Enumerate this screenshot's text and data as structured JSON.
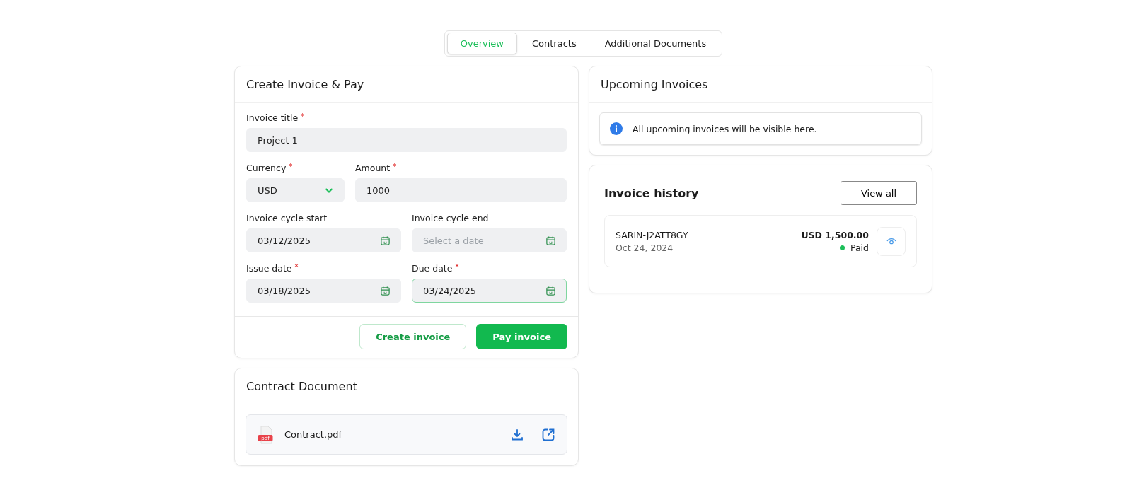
{
  "tabs": [
    {
      "label": "Overview",
      "selected": true
    },
    {
      "label": "Contracts",
      "selected": false
    },
    {
      "label": "Additional Documents",
      "selected": false
    }
  ],
  "create_invoice": {
    "title": "Create Invoice & Pay",
    "rows": [
      [
        {
          "kind": "text",
          "label": "Invoice title",
          "required": true,
          "value": "Project 1",
          "focused": false
        }
      ],
      [
        {
          "kind": "select",
          "label": "Currency",
          "required": true,
          "value": "USD",
          "focused": false
        },
        {
          "kind": "text",
          "label": "Amount",
          "required": true,
          "value": "1000",
          "focused": false
        }
      ],
      [
        {
          "kind": "date",
          "label": "Invoice cycle start",
          "required": false,
          "value": "03/12/2025",
          "focused": false
        },
        {
          "kind": "date",
          "label": "Invoice cycle end",
          "required": false,
          "placeholder": "Select a date",
          "focused": false
        }
      ],
      [
        {
          "kind": "date",
          "label": "Issue date",
          "required": true,
          "value": "03/18/2025",
          "focused": false
        },
        {
          "kind": "date",
          "label": "Due date",
          "required": true,
          "value": "03/24/2025",
          "focused": true
        }
      ]
    ],
    "required_mark": "*",
    "buttons": [
      {
        "label": "Create invoice",
        "kind": "outline"
      },
      {
        "label": "Pay invoice",
        "kind": "primary"
      }
    ]
  },
  "contract_document": {
    "title": "Contract Document",
    "file": {
      "name": "Contract.pdf",
      "type_badge": "pdf"
    }
  },
  "upcoming_invoices": {
    "title": "Upcoming Invoices",
    "notice": "All upcoming invoices will be visible here."
  },
  "invoice_history": {
    "title": "Invoice history",
    "view_all": "View all",
    "items": [
      {
        "id": "SARIN-J2ATT8GY",
        "date": "Oct 24, 2024",
        "amount": "USD 1,500.00",
        "status": "Paid",
        "color": "#1dbf5a"
      }
    ]
  }
}
